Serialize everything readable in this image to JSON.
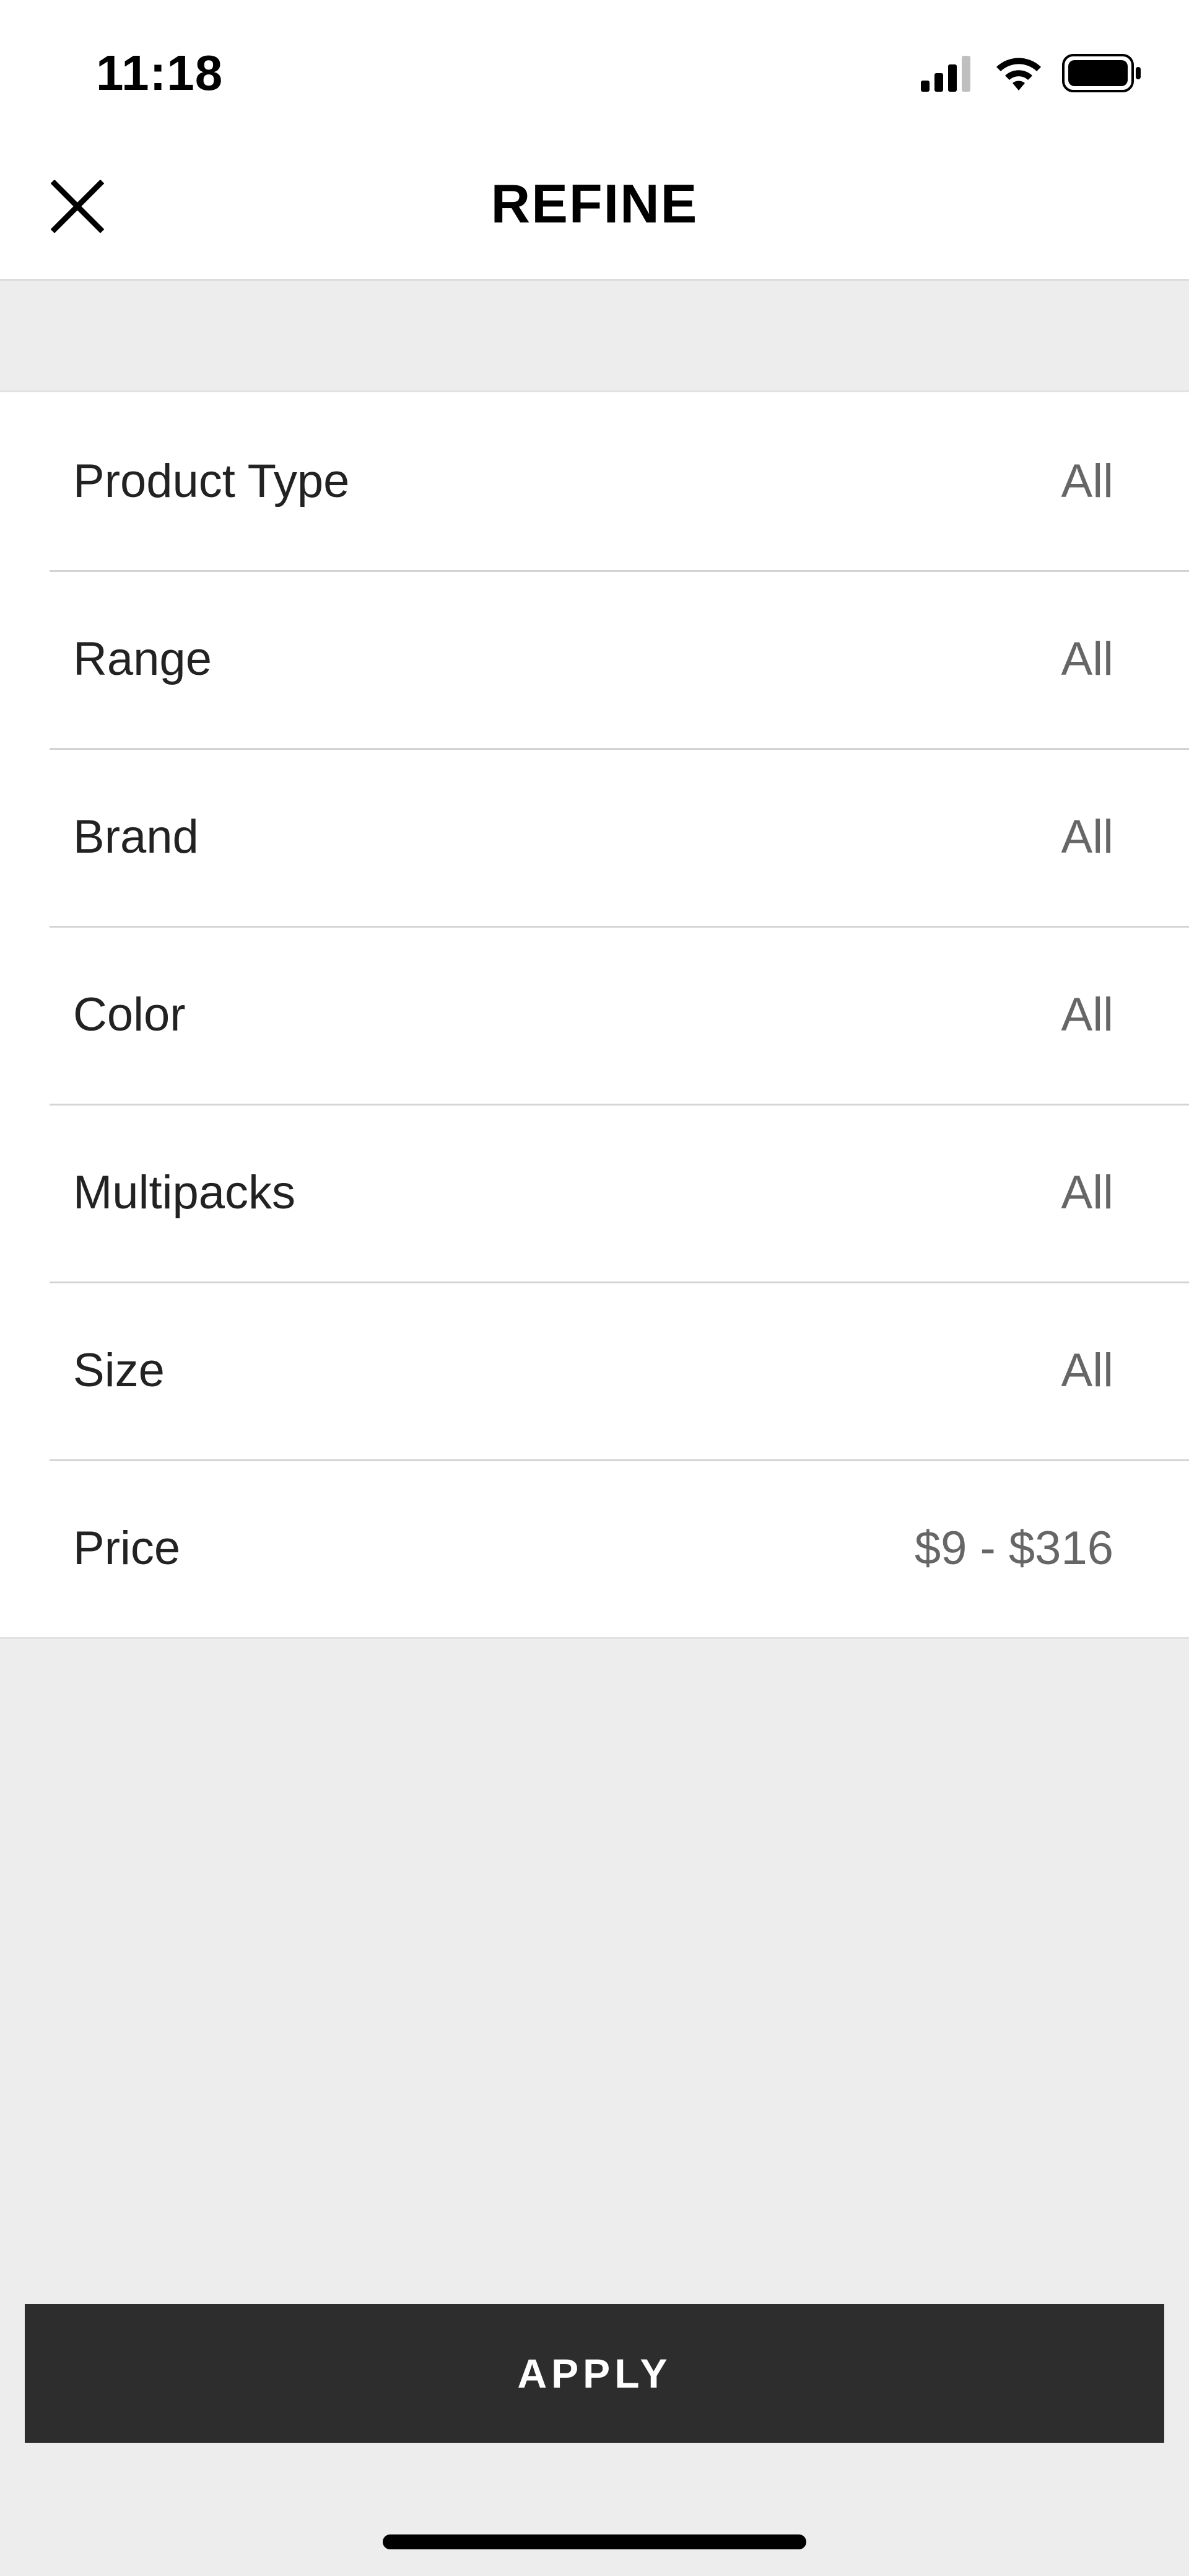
{
  "status_bar": {
    "time": "11:18",
    "icons": [
      "cellular-signal-icon",
      "wifi-icon",
      "battery-icon"
    ]
  },
  "header": {
    "title": "REFINE",
    "close_icon": "close-icon"
  },
  "filters": [
    {
      "label": "Product Type",
      "value": "All"
    },
    {
      "label": "Range",
      "value": "All"
    },
    {
      "label": "Brand",
      "value": "All"
    },
    {
      "label": "Color",
      "value": "All"
    },
    {
      "label": "Multipacks",
      "value": "All"
    },
    {
      "label": "Size",
      "value": "All"
    },
    {
      "label": "Price",
      "value": "$9 - $316"
    }
  ],
  "footer": {
    "apply_label": "APPLY"
  },
  "colors": {
    "background": "#ededed",
    "surface": "#ffffff",
    "apply_button": "#2d2d2d",
    "divider": "#d4d4d4",
    "value_text": "#666666"
  }
}
